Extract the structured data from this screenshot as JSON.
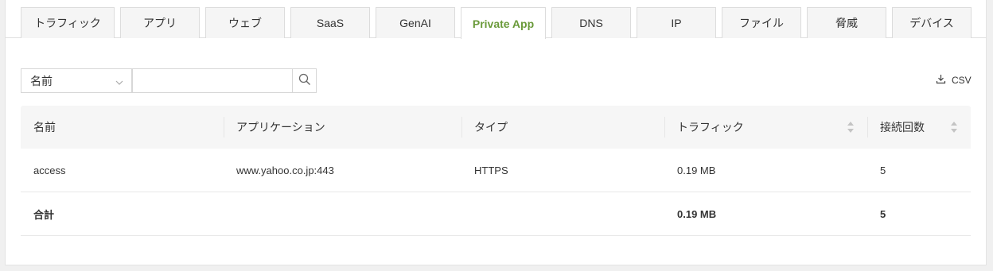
{
  "tabs": [
    {
      "label": "トラフィック",
      "active": false
    },
    {
      "label": "アプリ",
      "active": false
    },
    {
      "label": "ウェブ",
      "active": false
    },
    {
      "label": "SaaS",
      "active": false
    },
    {
      "label": "GenAI",
      "active": false
    },
    {
      "label": "Private App",
      "active": true
    },
    {
      "label": "DNS",
      "active": false
    },
    {
      "label": "IP",
      "active": false
    },
    {
      "label": "ファイル",
      "active": false
    },
    {
      "label": "脅威",
      "active": false
    },
    {
      "label": "デバイス",
      "active": false
    }
  ],
  "filter": {
    "field_value": "名前",
    "search_value": "",
    "search_icon": "search-icon"
  },
  "toolbar": {
    "csv_label": "CSV",
    "csv_icon": "download-icon"
  },
  "table": {
    "headers": [
      "名前",
      "アプリケーション",
      "タイプ",
      "トラフィック",
      "接続回数"
    ],
    "rows": [
      [
        "access",
        "www.yahoo.co.jp:443",
        "HTTPS",
        "0.19 MB",
        "5"
      ]
    ],
    "total": [
      "合計",
      "",
      "",
      "0.19 MB",
      "5"
    ]
  },
  "colors": {
    "active_tab": "#6a9a3a",
    "header_bg": "#f6f6f6",
    "border": "#dcdcdc"
  }
}
